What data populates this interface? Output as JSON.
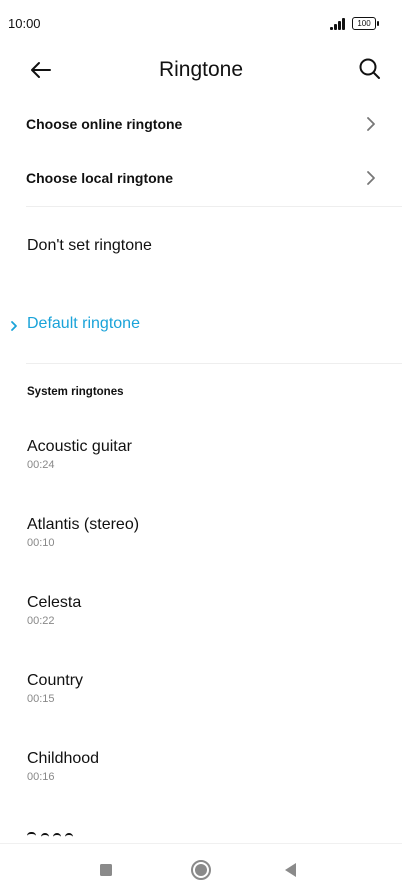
{
  "status_bar": {
    "time": "10:00",
    "battery": "100"
  },
  "header": {
    "title": "Ringtone",
    "back_icon": "arrow-left-icon",
    "search_icon": "search-icon"
  },
  "nav_items": [
    {
      "label": "Choose online ringtone",
      "icon": "chevron-right-icon"
    },
    {
      "label": "Choose local ringtone",
      "icon": "chevron-right-icon"
    }
  ],
  "options": [
    {
      "label": "Don't set ringtone",
      "selected": false
    },
    {
      "label": "Default ringtone",
      "selected": true
    }
  ],
  "accent_color": "#1aa3d9",
  "section": {
    "title": "System ringtones"
  },
  "ringtones": [
    {
      "name": "Acoustic guitar",
      "duration": "00:24"
    },
    {
      "name": "Atlantis (stereo)",
      "duration": "00:10"
    },
    {
      "name": "Celesta",
      "duration": "00:22"
    },
    {
      "name": "Country",
      "duration": "00:15"
    },
    {
      "name": "Childhood",
      "duration": "00:16"
    }
  ],
  "system_nav": {
    "recents_icon": "square-icon",
    "home_icon": "circle-icon",
    "back_icon": "triangle-back-icon"
  }
}
